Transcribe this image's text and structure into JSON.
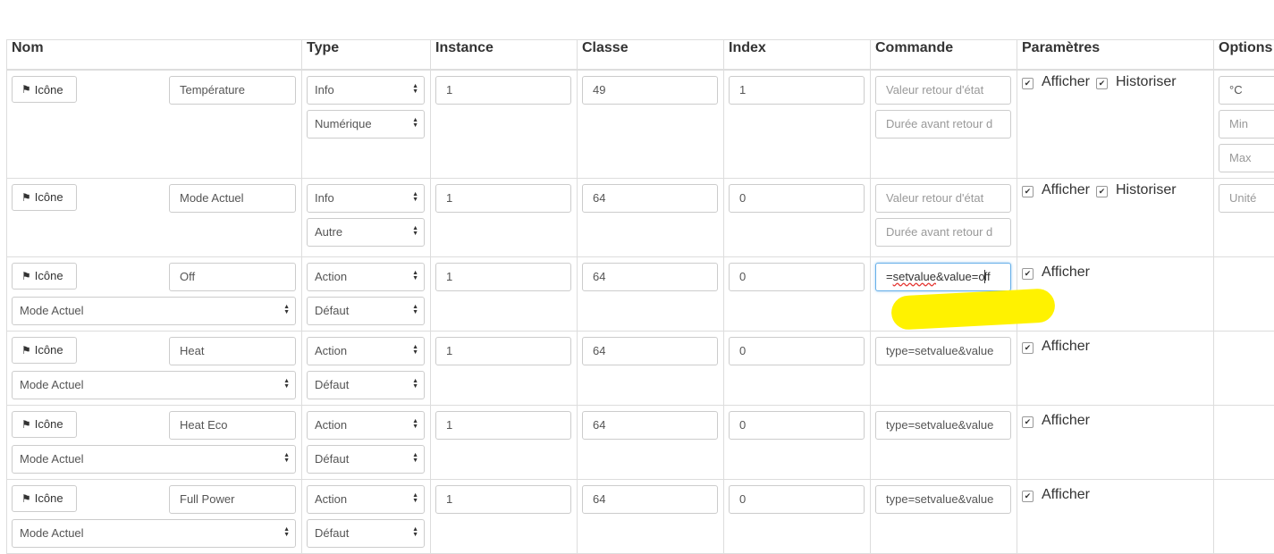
{
  "columns": [
    "Nom",
    "Type",
    "Instance",
    "Classe",
    "Index",
    "Commande",
    "Paramètres",
    "Options"
  ],
  "icon_button_label": "Icône",
  "rows": [
    {
      "name": "Température",
      "type": "Info",
      "subtype": "Numérique",
      "instance": "1",
      "classe": "49",
      "index": "1",
      "cmd_placeholder_1": "Valeur retour d'état",
      "cmd_placeholder_2": "Durée avant retour d",
      "afficher": "Afficher",
      "historiser": "Historiser",
      "opt_unit": "°C",
      "opt_min": "Min",
      "opt_max": "Max"
    },
    {
      "name": "Mode Actuel",
      "type": "Info",
      "subtype": "Autre",
      "instance": "1",
      "classe": "64",
      "index": "0",
      "cmd_placeholder_1": "Valeur retour d'état",
      "cmd_placeholder_2": "Durée avant retour d",
      "afficher": "Afficher",
      "historiser": "Historiser",
      "opt_unit_placeholder": "Unité"
    },
    {
      "name": "Off",
      "type": "Action",
      "subtype": "Défaut",
      "linked_info": "Mode Actuel",
      "instance": "1",
      "classe": "64",
      "index": "0",
      "cmd_pre": "=",
      "cmd_squiggle": "setvalue",
      "cmd_post1": "&value=o",
      "cmd_post2": "ff",
      "afficher": "Afficher"
    },
    {
      "name": "Heat",
      "type": "Action",
      "subtype": "Défaut",
      "linked_info": "Mode Actuel",
      "instance": "1",
      "classe": "64",
      "index": "0",
      "cmd": "type=setvalue&value",
      "afficher": "Afficher"
    },
    {
      "name": "Heat Eco",
      "type": "Action",
      "subtype": "Défaut",
      "linked_info": "Mode Actuel",
      "instance": "1",
      "classe": "64",
      "index": "0",
      "cmd": "type=setvalue&value",
      "afficher": "Afficher"
    },
    {
      "name": "Full Power",
      "type": "Action",
      "subtype": "Défaut",
      "linked_info": "Mode Actuel",
      "instance": "1",
      "classe": "64",
      "index": "0",
      "cmd": "type=setvalue&value",
      "afficher": "Afficher"
    }
  ],
  "highlight_color": "#fff200"
}
